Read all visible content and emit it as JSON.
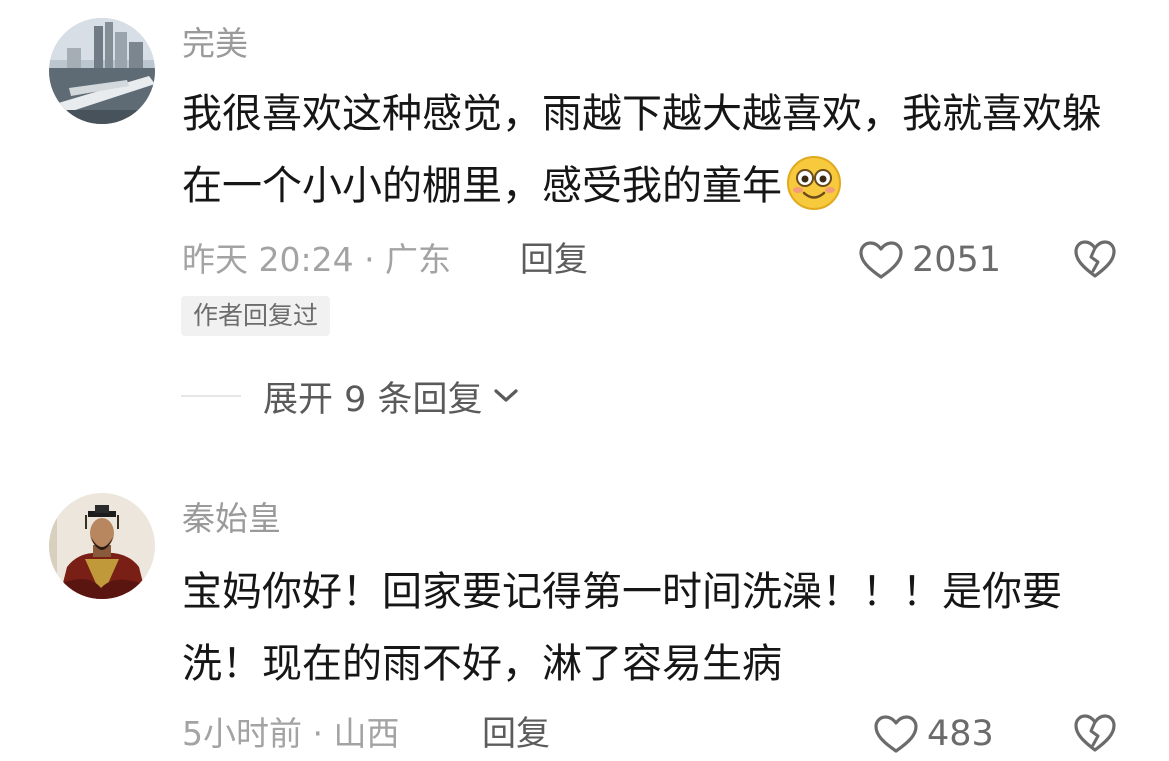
{
  "comments": [
    {
      "username": "完美",
      "content": "我很喜欢这种感觉，雨越下越大越喜欢，我就喜欢躲在一个小小的棚里，感受我的童年",
      "meta": "昨天 20:24 · 广东",
      "reply_label": "回复",
      "likes": "2051",
      "author_badge": "作者回复过",
      "expand_label": "展开 9 条回复",
      "avatar_icon": "city-building-avatar",
      "emoji_icon": "smiling-face-emoji"
    },
    {
      "username": "秦始皇",
      "content": "宝妈你好！回家要记得第一时间洗澡！！！是你要洗！现在的雨不好，淋了容易生病",
      "meta": "5小时前 · 山西",
      "reply_label": "回复",
      "likes": "483",
      "avatar_icon": "emperor-portrait-avatar"
    }
  ],
  "icons": {
    "like": "heart-outline-icon",
    "dislike": "broken-heart-icon",
    "expand": "chevron-down-icon"
  },
  "colors": {
    "text_primary": "#161616",
    "text_secondary": "#9a9a9a",
    "badge_bg": "#f1f1f1"
  }
}
